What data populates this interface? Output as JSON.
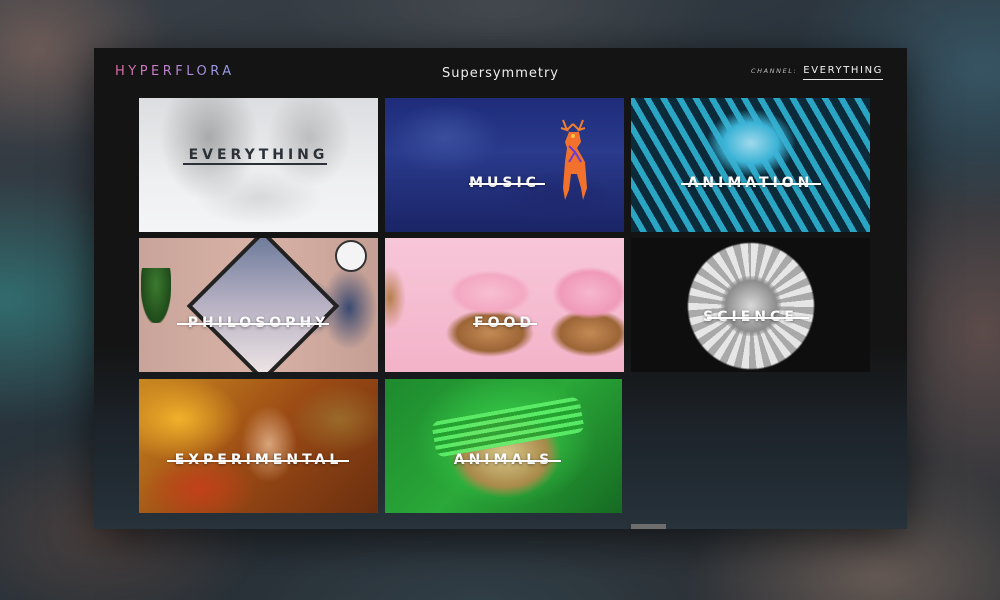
{
  "app": {
    "logo": "HYPERFLORA",
    "title": "Supersymmetry",
    "channel_label": "CHANNEL:",
    "channel_value": "EVERYTHING"
  },
  "tiles": [
    {
      "label": "EVERYTHING",
      "theme": "light"
    },
    {
      "label": "MUSIC",
      "theme": "dark-image"
    },
    {
      "label": "ANIMATION",
      "theme": "dark-image"
    },
    {
      "label": "PHILOSOPHY",
      "theme": "dark-image"
    },
    {
      "label": "FOOD",
      "theme": "dark-image"
    },
    {
      "label": "SCIENCE",
      "theme": "dark-image"
    },
    {
      "label": "EXPERIMENTAL",
      "theme": "dark-image"
    },
    {
      "label": "ANIMALS",
      "theme": "dark-image"
    }
  ],
  "colors": {
    "logo_gradient_start": "#e06aa8",
    "logo_gradient_end": "#8f9ee6",
    "window_bg": "#141414",
    "label_light": "#ffffff",
    "label_dark": "#2c3138"
  }
}
